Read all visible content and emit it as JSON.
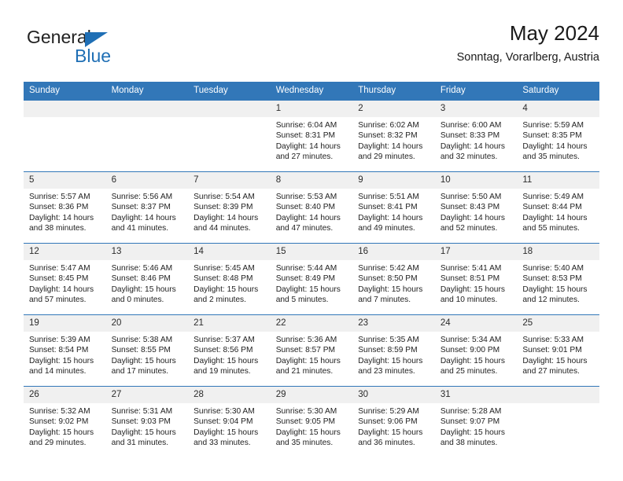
{
  "brand": {
    "name_part1": "General",
    "name_part2": "Blue",
    "triangle_icon": "triangle-icon",
    "colors": {
      "blue": "#1f6fb5",
      "dark": "#212121"
    }
  },
  "header": {
    "title": "May 2024",
    "subtitle": "Sonntag, Vorarlberg, Austria"
  },
  "theme": {
    "header_bar": "#3277b8",
    "daynum_band": "#f0f0f0",
    "text": "#222222"
  },
  "weekday_headers": [
    "Sunday",
    "Monday",
    "Tuesday",
    "Wednesday",
    "Thursday",
    "Friday",
    "Saturday"
  ],
  "labels": {
    "sunrise_prefix": "Sunrise:",
    "sunset_prefix": "Sunset:",
    "daylight_prefix": "Daylight:"
  },
  "weeks": [
    [
      {
        "day": "",
        "empty": true
      },
      {
        "day": "",
        "empty": true
      },
      {
        "day": "",
        "empty": true
      },
      {
        "day": "1",
        "sunrise": "Sunrise: 6:04 AM",
        "sunset": "Sunset: 8:31 PM",
        "daylight_line1": "Daylight: 14 hours",
        "daylight_line2": "and 27 minutes."
      },
      {
        "day": "2",
        "sunrise": "Sunrise: 6:02 AM",
        "sunset": "Sunset: 8:32 PM",
        "daylight_line1": "Daylight: 14 hours",
        "daylight_line2": "and 29 minutes."
      },
      {
        "day": "3",
        "sunrise": "Sunrise: 6:00 AM",
        "sunset": "Sunset: 8:33 PM",
        "daylight_line1": "Daylight: 14 hours",
        "daylight_line2": "and 32 minutes."
      },
      {
        "day": "4",
        "sunrise": "Sunrise: 5:59 AM",
        "sunset": "Sunset: 8:35 PM",
        "daylight_line1": "Daylight: 14 hours",
        "daylight_line2": "and 35 minutes."
      }
    ],
    [
      {
        "day": "5",
        "sunrise": "Sunrise: 5:57 AM",
        "sunset": "Sunset: 8:36 PM",
        "daylight_line1": "Daylight: 14 hours",
        "daylight_line2": "and 38 minutes."
      },
      {
        "day": "6",
        "sunrise": "Sunrise: 5:56 AM",
        "sunset": "Sunset: 8:37 PM",
        "daylight_line1": "Daylight: 14 hours",
        "daylight_line2": "and 41 minutes."
      },
      {
        "day": "7",
        "sunrise": "Sunrise: 5:54 AM",
        "sunset": "Sunset: 8:39 PM",
        "daylight_line1": "Daylight: 14 hours",
        "daylight_line2": "and 44 minutes."
      },
      {
        "day": "8",
        "sunrise": "Sunrise: 5:53 AM",
        "sunset": "Sunset: 8:40 PM",
        "daylight_line1": "Daylight: 14 hours",
        "daylight_line2": "and 47 minutes."
      },
      {
        "day": "9",
        "sunrise": "Sunrise: 5:51 AM",
        "sunset": "Sunset: 8:41 PM",
        "daylight_line1": "Daylight: 14 hours",
        "daylight_line2": "and 49 minutes."
      },
      {
        "day": "10",
        "sunrise": "Sunrise: 5:50 AM",
        "sunset": "Sunset: 8:43 PM",
        "daylight_line1": "Daylight: 14 hours",
        "daylight_line2": "and 52 minutes."
      },
      {
        "day": "11",
        "sunrise": "Sunrise: 5:49 AM",
        "sunset": "Sunset: 8:44 PM",
        "daylight_line1": "Daylight: 14 hours",
        "daylight_line2": "and 55 minutes."
      }
    ],
    [
      {
        "day": "12",
        "sunrise": "Sunrise: 5:47 AM",
        "sunset": "Sunset: 8:45 PM",
        "daylight_line1": "Daylight: 14 hours",
        "daylight_line2": "and 57 minutes."
      },
      {
        "day": "13",
        "sunrise": "Sunrise: 5:46 AM",
        "sunset": "Sunset: 8:46 PM",
        "daylight_line1": "Daylight: 15 hours",
        "daylight_line2": "and 0 minutes."
      },
      {
        "day": "14",
        "sunrise": "Sunrise: 5:45 AM",
        "sunset": "Sunset: 8:48 PM",
        "daylight_line1": "Daylight: 15 hours",
        "daylight_line2": "and 2 minutes."
      },
      {
        "day": "15",
        "sunrise": "Sunrise: 5:44 AM",
        "sunset": "Sunset: 8:49 PM",
        "daylight_line1": "Daylight: 15 hours",
        "daylight_line2": "and 5 minutes."
      },
      {
        "day": "16",
        "sunrise": "Sunrise: 5:42 AM",
        "sunset": "Sunset: 8:50 PM",
        "daylight_line1": "Daylight: 15 hours",
        "daylight_line2": "and 7 minutes."
      },
      {
        "day": "17",
        "sunrise": "Sunrise: 5:41 AM",
        "sunset": "Sunset: 8:51 PM",
        "daylight_line1": "Daylight: 15 hours",
        "daylight_line2": "and 10 minutes."
      },
      {
        "day": "18",
        "sunrise": "Sunrise: 5:40 AM",
        "sunset": "Sunset: 8:53 PM",
        "daylight_line1": "Daylight: 15 hours",
        "daylight_line2": "and 12 minutes."
      }
    ],
    [
      {
        "day": "19",
        "sunrise": "Sunrise: 5:39 AM",
        "sunset": "Sunset: 8:54 PM",
        "daylight_line1": "Daylight: 15 hours",
        "daylight_line2": "and 14 minutes."
      },
      {
        "day": "20",
        "sunrise": "Sunrise: 5:38 AM",
        "sunset": "Sunset: 8:55 PM",
        "daylight_line1": "Daylight: 15 hours",
        "daylight_line2": "and 17 minutes."
      },
      {
        "day": "21",
        "sunrise": "Sunrise: 5:37 AM",
        "sunset": "Sunset: 8:56 PM",
        "daylight_line1": "Daylight: 15 hours",
        "daylight_line2": "and 19 minutes."
      },
      {
        "day": "22",
        "sunrise": "Sunrise: 5:36 AM",
        "sunset": "Sunset: 8:57 PM",
        "daylight_line1": "Daylight: 15 hours",
        "daylight_line2": "and 21 minutes."
      },
      {
        "day": "23",
        "sunrise": "Sunrise: 5:35 AM",
        "sunset": "Sunset: 8:59 PM",
        "daylight_line1": "Daylight: 15 hours",
        "daylight_line2": "and 23 minutes."
      },
      {
        "day": "24",
        "sunrise": "Sunrise: 5:34 AM",
        "sunset": "Sunset: 9:00 PM",
        "daylight_line1": "Daylight: 15 hours",
        "daylight_line2": "and 25 minutes."
      },
      {
        "day": "25",
        "sunrise": "Sunrise: 5:33 AM",
        "sunset": "Sunset: 9:01 PM",
        "daylight_line1": "Daylight: 15 hours",
        "daylight_line2": "and 27 minutes."
      }
    ],
    [
      {
        "day": "26",
        "sunrise": "Sunrise: 5:32 AM",
        "sunset": "Sunset: 9:02 PM",
        "daylight_line1": "Daylight: 15 hours",
        "daylight_line2": "and 29 minutes."
      },
      {
        "day": "27",
        "sunrise": "Sunrise: 5:31 AM",
        "sunset": "Sunset: 9:03 PM",
        "daylight_line1": "Daylight: 15 hours",
        "daylight_line2": "and 31 minutes."
      },
      {
        "day": "28",
        "sunrise": "Sunrise: 5:30 AM",
        "sunset": "Sunset: 9:04 PM",
        "daylight_line1": "Daylight: 15 hours",
        "daylight_line2": "and 33 minutes."
      },
      {
        "day": "29",
        "sunrise": "Sunrise: 5:30 AM",
        "sunset": "Sunset: 9:05 PM",
        "daylight_line1": "Daylight: 15 hours",
        "daylight_line2": "and 35 minutes."
      },
      {
        "day": "30",
        "sunrise": "Sunrise: 5:29 AM",
        "sunset": "Sunset: 9:06 PM",
        "daylight_line1": "Daylight: 15 hours",
        "daylight_line2": "and 36 minutes."
      },
      {
        "day": "31",
        "sunrise": "Sunrise: 5:28 AM",
        "sunset": "Sunset: 9:07 PM",
        "daylight_line1": "Daylight: 15 hours",
        "daylight_line2": "and 38 minutes."
      },
      {
        "day": "",
        "empty": true
      }
    ]
  ]
}
